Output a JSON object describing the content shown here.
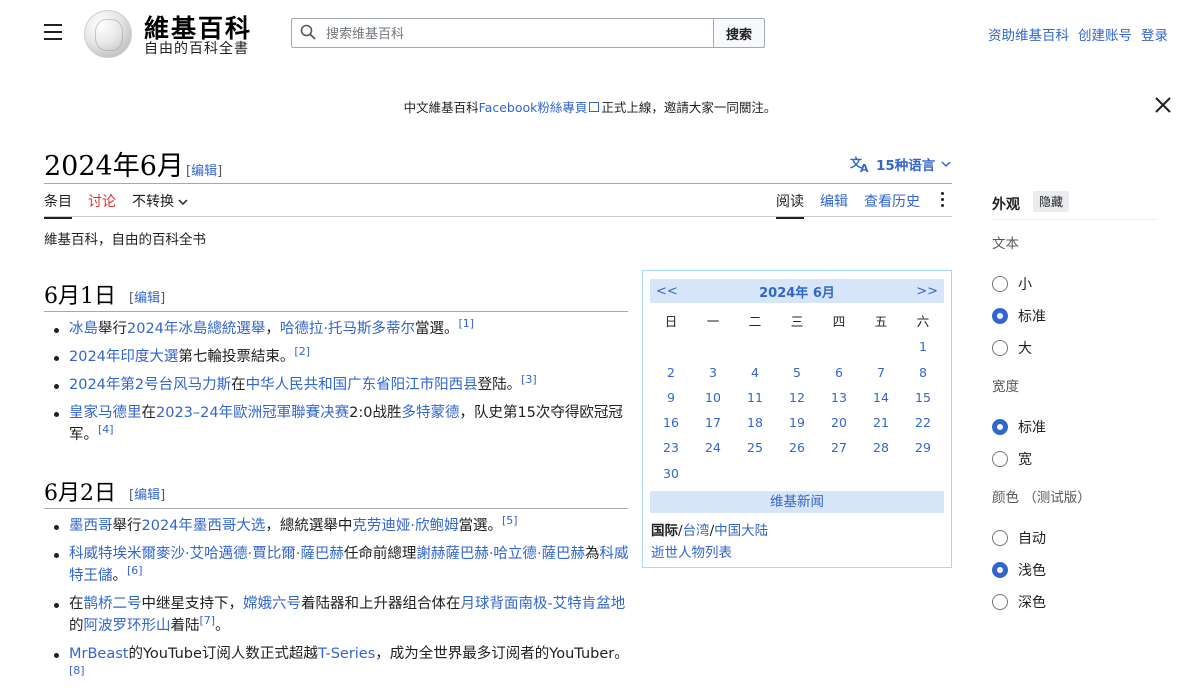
{
  "header": {
    "wordmark": "維基百科",
    "tagline": "自由的百科全書",
    "search_placeholder": "搜索维基百科",
    "search_button": "搜索",
    "links": [
      "资助维基百科",
      "创建账号",
      "登录"
    ]
  },
  "banner": {
    "prefix": "中文維基百科",
    "link": "Facebook粉絲專頁",
    "suffix": "正式上線，邀請大家一同關注。"
  },
  "page": {
    "title": "2024年6月",
    "edit": "编辑",
    "languages": "15种语言",
    "tabs_left": [
      "条目",
      "讨论",
      "不转换"
    ],
    "tabs_right": [
      "阅读",
      "编辑",
      "查看历史"
    ],
    "site_sub": "維基百科，自由的百科全书"
  },
  "sections": [
    {
      "heading": "6月1日",
      "edit": "编辑",
      "items": [
        [
          {
            "t": "冰島",
            "l": true
          },
          {
            "t": "舉行"
          },
          {
            "t": "2024年冰島總統選舉",
            "l": true
          },
          {
            "t": "，"
          },
          {
            "t": "哈德拉·托马斯多蒂尔",
            "l": true
          },
          {
            "t": "當選。"
          },
          {
            "t": "[1]",
            "s": true
          }
        ],
        [
          {
            "t": "2024年印度大選",
            "l": true
          },
          {
            "t": "第七輪投票結束。"
          },
          {
            "t": "[2]",
            "s": true
          }
        ],
        [
          {
            "t": "2024年第2号台风马力斯",
            "l": true
          },
          {
            "t": "在"
          },
          {
            "t": "中华人民共和国",
            "l": true
          },
          {
            "t": "广东省",
            "l": true
          },
          {
            "t": "阳江市",
            "l": true
          },
          {
            "t": "阳西县",
            "l": true
          },
          {
            "t": "登陆。"
          },
          {
            "t": "[3]",
            "s": true
          }
        ],
        [
          {
            "t": "皇家马德里",
            "l": true
          },
          {
            "t": "在"
          },
          {
            "t": "2023–24年歐洲冠軍聯賽",
            "l": true
          },
          {
            "t": "决赛",
            "l": true
          },
          {
            "t": "2:0战胜"
          },
          {
            "t": "多特蒙德",
            "l": true
          },
          {
            "t": "，队史第15次夺得欧冠冠军。"
          },
          {
            "t": "[4]",
            "s": true
          }
        ]
      ]
    },
    {
      "heading": "6月2日",
      "edit": "编辑",
      "items": [
        [
          {
            "t": "墨西哥",
            "l": true
          },
          {
            "t": "舉行"
          },
          {
            "t": "2024年墨西哥大选",
            "l": true
          },
          {
            "t": "，總統選舉中"
          },
          {
            "t": "克劳迪娅·欣鲍姆",
            "l": true
          },
          {
            "t": "當選。"
          },
          {
            "t": "[5]",
            "s": true
          }
        ],
        [
          {
            "t": "科威特埃米爾",
            "l": true
          },
          {
            "t": "麥沙·艾哈邁德·賈比爾·薩巴赫",
            "l": true
          },
          {
            "t": "任命前總理"
          },
          {
            "t": "謝赫薩巴赫·哈立德·薩巴赫",
            "l": true
          },
          {
            "t": "為"
          },
          {
            "t": "科威特王儲",
            "l": true
          },
          {
            "t": "。"
          },
          {
            "t": "[6]",
            "s": true
          }
        ],
        [
          {
            "t": "在"
          },
          {
            "t": "鹊桥二号",
            "l": true
          },
          {
            "t": "中继星支持下，"
          },
          {
            "t": "嫦娥六号",
            "l": true
          },
          {
            "t": "着陆器和上升器组合体在"
          },
          {
            "t": "月球背面",
            "l": true
          },
          {
            "t": "南极-艾特肯盆地",
            "l": true
          },
          {
            "t": "的"
          },
          {
            "t": "阿波罗环形山",
            "l": true
          },
          {
            "t": "着陆"
          },
          {
            "t": "[7]",
            "s": true
          },
          {
            "t": "。"
          }
        ],
        [
          {
            "t": "MrBeast",
            "l": true
          },
          {
            "t": "的YouTube订阅人数正式超越"
          },
          {
            "t": "T-Series",
            "l": true
          },
          {
            "t": "，成为全世界最多订阅者的YouTuber。"
          },
          {
            "t": "[8]",
            "s": true
          }
        ]
      ]
    }
  ],
  "calendar": {
    "prev": "<<",
    "next": ">>",
    "title": "2024年 6月",
    "weekdays": [
      "日",
      "一",
      "二",
      "三",
      "四",
      "五",
      "六"
    ],
    "days": [
      "",
      "",
      "",
      "",
      "",
      "",
      "1",
      "2",
      "3",
      "4",
      "5",
      "6",
      "7",
      "8",
      "9",
      "10",
      "11",
      "12",
      "13",
      "14",
      "15",
      "16",
      "17",
      "18",
      "19",
      "20",
      "21",
      "22",
      "23",
      "24",
      "25",
      "26",
      "27",
      "28",
      "29",
      "30"
    ],
    "news_label": "维基新闻",
    "line1_bold": "国际",
    "line1_sep": "/",
    "line1_a": "台湾",
    "line1_b": "中国大陆",
    "line2": "逝世人物列表"
  },
  "appearance": {
    "title": "外观",
    "hide": "隐藏",
    "text_label": "文本",
    "text_options": [
      "小",
      "标准",
      "大"
    ],
    "text_selected": "标准",
    "width_label": "宽度",
    "width_options": [
      "标准",
      "宽"
    ],
    "width_selected": "标准",
    "color_label": "颜色 （测试版）",
    "color_options": [
      "自动",
      "浅色",
      "深色"
    ],
    "color_selected": "浅色"
  },
  "colors": {
    "link": "#3366cc",
    "talk": "#d73333",
    "calendar_header": "#d7e5f8"
  }
}
